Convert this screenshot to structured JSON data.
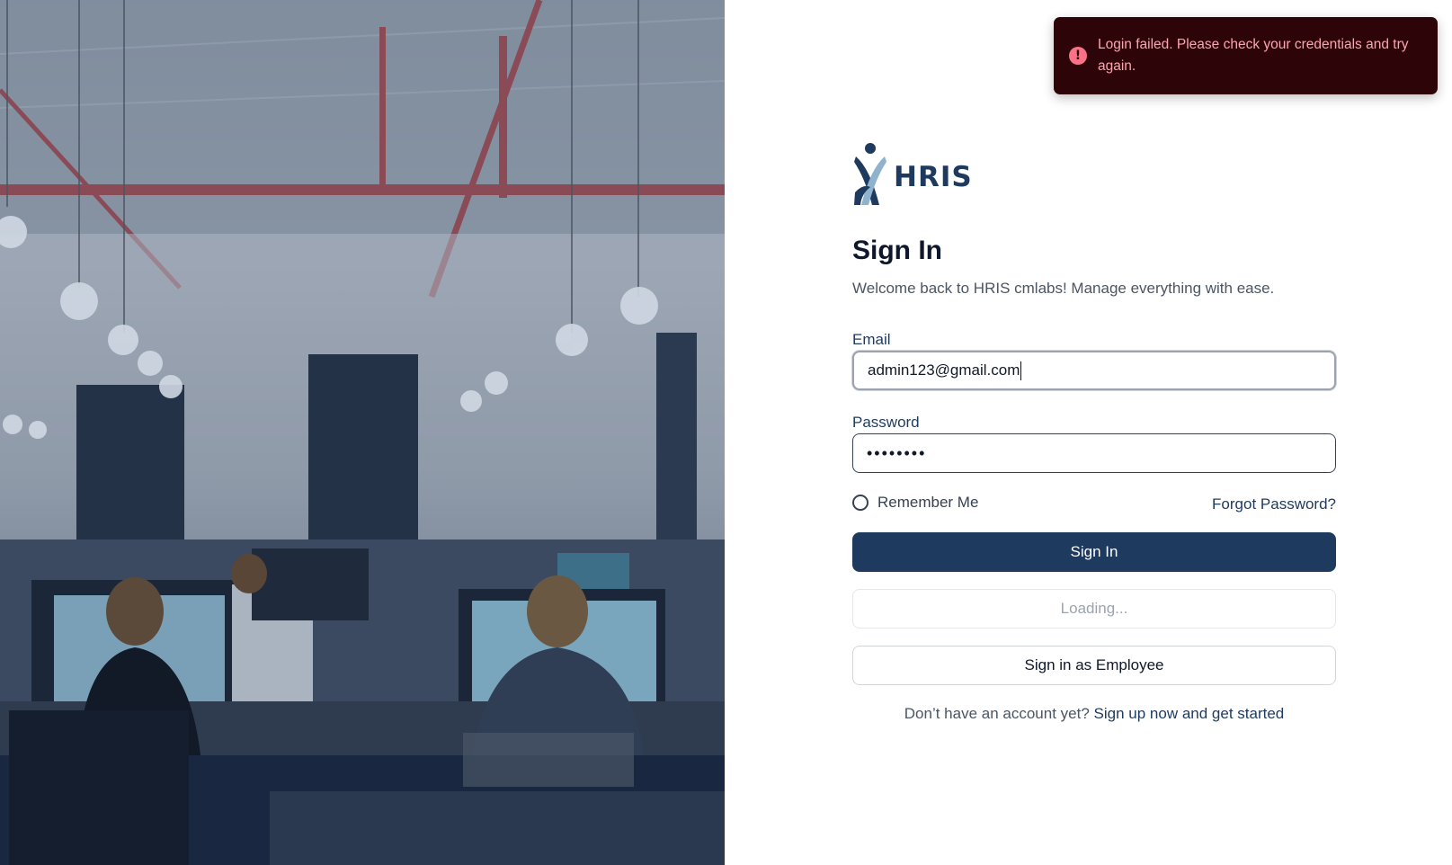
{
  "toast": {
    "message": "Login failed. Please check your credentials and try again.",
    "icon": "alert-circle-icon",
    "icon_glyph": "!",
    "background": "#2d0509",
    "text_color": "#fda4af"
  },
  "brand": {
    "name": "HRIS",
    "logo_icon": "hris-logo-icon"
  },
  "form": {
    "title": "Sign In",
    "subtitle": "Welcome back to HRIS cmlabs! Manage everything with ease.",
    "email_label": "Email",
    "email_value": "admin123@gmail.com",
    "password_label": "Password",
    "password_masked": "••••••••",
    "remember_label": "Remember Me",
    "forgot_label": "Forgot Password?",
    "sign_in_label": "Sign In",
    "loading_label": "Loading...",
    "employee_label": "Sign in as Employee",
    "signup_prompt": "Don’t have an account yet?",
    "signup_link": "Sign up now and get started"
  },
  "colors": {
    "primary": "#1e3a5f",
    "logo_dark": "#1f3a5f",
    "logo_light": "#8fb3cc"
  }
}
